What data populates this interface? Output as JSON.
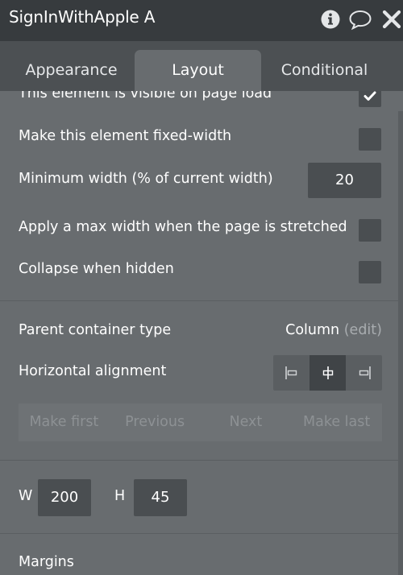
{
  "window": {
    "title": "SignInWithApple A",
    "icons": [
      "info-icon",
      "comment-icon",
      "close-icon"
    ]
  },
  "tabs": [
    {
      "label": "Appearance",
      "active": false
    },
    {
      "label": "Layout",
      "active": true
    },
    {
      "label": "Conditional",
      "active": false
    }
  ],
  "layout": {
    "visible_on_load": {
      "label": "This element is visible on page load",
      "checked": true
    },
    "fixed_width": {
      "label": "Make this element fixed-width",
      "checked": false
    },
    "min_width": {
      "label": "Minimum width (% of current width)",
      "value": "20"
    },
    "max_width": {
      "label": "Apply a max width when the page is stretched",
      "checked": false
    },
    "collapse_hidden": {
      "label": "Collapse when hidden",
      "checked": false
    },
    "parent_container": {
      "label": "Parent container type",
      "value": "Column",
      "edit": "(edit)"
    },
    "horizontal_alignment": {
      "label": "Horizontal alignment",
      "options": [
        "align-left-icon",
        "align-center-icon",
        "align-right-icon"
      ],
      "selected": "align-center-icon"
    },
    "order_buttons": [
      "Make first",
      "Previous",
      "Next",
      "Make last"
    ],
    "size": {
      "w_label": "W",
      "w_value": "200",
      "h_label": "H",
      "h_value": "45"
    },
    "margins_label": "Margins"
  },
  "colors": {
    "title_bar": "#373b3e",
    "tab_bar": "#4c5053",
    "panel": "#686c6f",
    "input_bg": "#4a4e51",
    "selected_button": "#404447"
  }
}
